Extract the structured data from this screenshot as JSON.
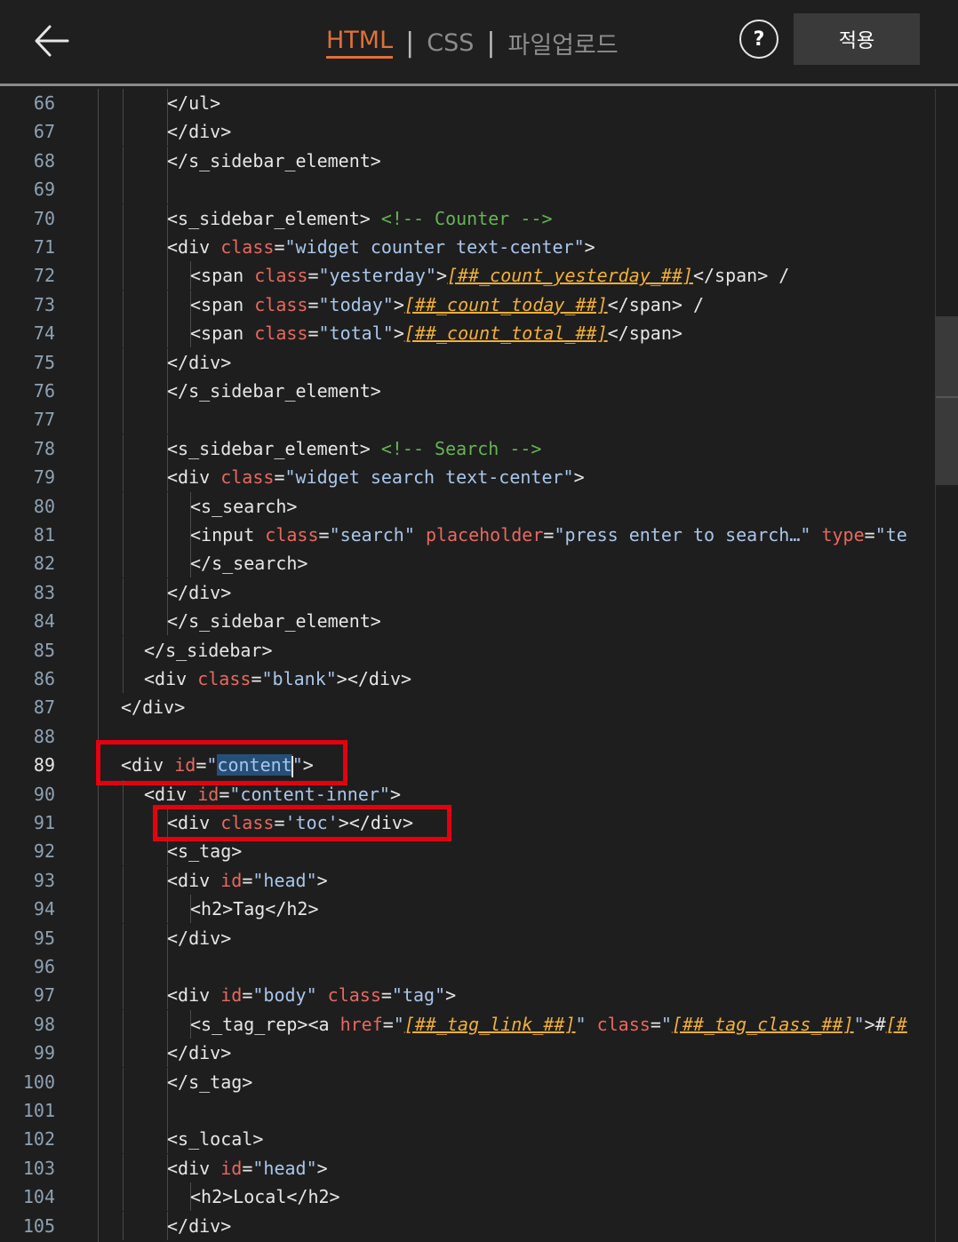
{
  "header": {
    "tabs": [
      {
        "label": "HTML",
        "active": true
      },
      {
        "label": "CSS",
        "active": false
      },
      {
        "label": "파일업로드",
        "active": false
      }
    ],
    "separator": "|",
    "help_label": "?",
    "apply_label": "적용",
    "back_icon": "arrow-left-icon"
  },
  "colors": {
    "accent": "#e0703a",
    "background": "#1e1e1e",
    "highlight_box": "#e3000f",
    "attr": "#e8685f",
    "string": "#a9c6ea",
    "comment": "#66b356",
    "template": "#f2b035"
  },
  "editor": {
    "current_line": "89",
    "lines": [
      {
        "n": "66",
        "indent": 2,
        "t": [
          [
            "tag",
            "</ul>"
          ]
        ]
      },
      {
        "n": "67",
        "indent": 2,
        "t": [
          [
            "tag",
            "</div>"
          ]
        ]
      },
      {
        "n": "68",
        "indent": 2,
        "t": [
          [
            "tag",
            "</s_sidebar_element>"
          ]
        ]
      },
      {
        "n": "69",
        "indent": 2,
        "t": []
      },
      {
        "n": "70",
        "indent": 2,
        "t": [
          [
            "tag",
            "<s_sidebar_element> "
          ],
          [
            "cmt",
            "<!-- Counter -->"
          ]
        ]
      },
      {
        "n": "71",
        "indent": 2,
        "t": [
          [
            "tag",
            "<div "
          ],
          [
            "attr",
            "class"
          ],
          [
            "tag",
            "="
          ],
          [
            "str",
            "\"widget counter text-center\""
          ],
          [
            "tag",
            ">"
          ]
        ]
      },
      {
        "n": "72",
        "indent": 3,
        "t": [
          [
            "tag",
            "<span "
          ],
          [
            "attr",
            "class"
          ],
          [
            "tag",
            "="
          ],
          [
            "str",
            "\"yesterday\""
          ],
          [
            "tag",
            ">"
          ],
          [
            "tpl",
            "[##_count_yesterday_##]"
          ],
          [
            "tag",
            "</span> /"
          ]
        ]
      },
      {
        "n": "73",
        "indent": 3,
        "t": [
          [
            "tag",
            "<span "
          ],
          [
            "attr",
            "class"
          ],
          [
            "tag",
            "="
          ],
          [
            "str",
            "\"today\""
          ],
          [
            "tag",
            ">"
          ],
          [
            "tpl",
            "[##_count_today_##]"
          ],
          [
            "tag",
            "</span> /"
          ]
        ]
      },
      {
        "n": "74",
        "indent": 3,
        "t": [
          [
            "tag",
            "<span "
          ],
          [
            "attr",
            "class"
          ],
          [
            "tag",
            "="
          ],
          [
            "str",
            "\"total\""
          ],
          [
            "tag",
            ">"
          ],
          [
            "tpl",
            "[##_count_total_##]"
          ],
          [
            "tag",
            "</span>"
          ]
        ]
      },
      {
        "n": "75",
        "indent": 2,
        "t": [
          [
            "tag",
            "</div>"
          ]
        ]
      },
      {
        "n": "76",
        "indent": 2,
        "t": [
          [
            "tag",
            "</s_sidebar_element>"
          ]
        ]
      },
      {
        "n": "77",
        "indent": 2,
        "t": []
      },
      {
        "n": "78",
        "indent": 2,
        "t": [
          [
            "tag",
            "<s_sidebar_element> "
          ],
          [
            "cmt",
            "<!-- Search -->"
          ]
        ]
      },
      {
        "n": "79",
        "indent": 2,
        "t": [
          [
            "tag",
            "<div "
          ],
          [
            "attr",
            "class"
          ],
          [
            "tag",
            "="
          ],
          [
            "str",
            "\"widget search text-center\""
          ],
          [
            "tag",
            ">"
          ]
        ]
      },
      {
        "n": "80",
        "indent": 3,
        "t": [
          [
            "tag",
            "<s_search>"
          ]
        ]
      },
      {
        "n": "81",
        "indent": 3,
        "t": [
          [
            "tag",
            "<input "
          ],
          [
            "attr",
            "class"
          ],
          [
            "tag",
            "="
          ],
          [
            "str",
            "\"search\" "
          ],
          [
            "attr",
            "placeholder"
          ],
          [
            "tag",
            "="
          ],
          [
            "str",
            "\"press enter to search…\" "
          ],
          [
            "attr",
            "type"
          ],
          [
            "tag",
            "="
          ],
          [
            "str",
            "\"te"
          ]
        ]
      },
      {
        "n": "82",
        "indent": 3,
        "t": [
          [
            "tag",
            "</s_search>"
          ]
        ]
      },
      {
        "n": "83",
        "indent": 2,
        "t": [
          [
            "tag",
            "</div>"
          ]
        ]
      },
      {
        "n": "84",
        "indent": 2,
        "t": [
          [
            "tag",
            "</s_sidebar_element>"
          ]
        ]
      },
      {
        "n": "85",
        "indent": 1,
        "t": [
          [
            "tag",
            "</s_sidebar>"
          ]
        ]
      },
      {
        "n": "86",
        "indent": 1,
        "t": [
          [
            "tag",
            "<div "
          ],
          [
            "attr",
            "class"
          ],
          [
            "tag",
            "="
          ],
          [
            "str",
            "\"blank\""
          ],
          [
            "tag",
            "></div>"
          ]
        ]
      },
      {
        "n": "87",
        "indent": 0,
        "t": [
          [
            "tag",
            "</div>"
          ]
        ]
      },
      {
        "n": "88",
        "indent": 0,
        "t": []
      },
      {
        "n": "89",
        "indent": 0,
        "t": [
          [
            "tag",
            "<div "
          ],
          [
            "attr",
            "id"
          ],
          [
            "tag",
            "="
          ],
          [
            "str",
            "\""
          ],
          [
            "sel",
            "content"
          ],
          [
            "caret",
            ""
          ],
          [
            "str",
            "\""
          ],
          [
            "tag",
            ">"
          ]
        ]
      },
      {
        "n": "90",
        "indent": 1,
        "t": [
          [
            "tag",
            "<div "
          ],
          [
            "attr",
            "id"
          ],
          [
            "tag",
            "="
          ],
          [
            "str",
            "\"content-inner\""
          ],
          [
            "tag",
            ">"
          ]
        ]
      },
      {
        "n": "91",
        "indent": 2,
        "t": [
          [
            "tag",
            "<div "
          ],
          [
            "attr",
            "class"
          ],
          [
            "tag",
            "="
          ],
          [
            "str",
            "'toc'"
          ],
          [
            "tag",
            "></div>"
          ]
        ]
      },
      {
        "n": "92",
        "indent": 2,
        "t": [
          [
            "tag",
            "<s_tag>"
          ]
        ]
      },
      {
        "n": "93",
        "indent": 2,
        "t": [
          [
            "tag",
            "<div "
          ],
          [
            "attr",
            "id"
          ],
          [
            "tag",
            "="
          ],
          [
            "str",
            "\"head\""
          ],
          [
            "tag",
            ">"
          ]
        ]
      },
      {
        "n": "94",
        "indent": 3,
        "t": [
          [
            "tag",
            "<h2>Tag</h2>"
          ]
        ]
      },
      {
        "n": "95",
        "indent": 2,
        "t": [
          [
            "tag",
            "</div>"
          ]
        ]
      },
      {
        "n": "96",
        "indent": 2,
        "t": []
      },
      {
        "n": "97",
        "indent": 2,
        "t": [
          [
            "tag",
            "<div "
          ],
          [
            "attr",
            "id"
          ],
          [
            "tag",
            "="
          ],
          [
            "str",
            "\"body\" "
          ],
          [
            "attr",
            "class"
          ],
          [
            "tag",
            "="
          ],
          [
            "str",
            "\"tag\""
          ],
          [
            "tag",
            ">"
          ]
        ]
      },
      {
        "n": "98",
        "indent": 3,
        "t": [
          [
            "tag",
            "<s_tag_rep><a "
          ],
          [
            "attr",
            "href"
          ],
          [
            "tag",
            "="
          ],
          [
            "str",
            "\""
          ],
          [
            "tpl",
            "[##_tag_link_##]"
          ],
          [
            "str",
            "\" "
          ],
          [
            "attr",
            "class"
          ],
          [
            "tag",
            "="
          ],
          [
            "str",
            "\""
          ],
          [
            "tpl",
            "[##_tag_class_##]"
          ],
          [
            "str",
            "\""
          ],
          [
            "tag",
            ">#"
          ],
          [
            "tpl",
            "[#"
          ]
        ]
      },
      {
        "n": "99",
        "indent": 2,
        "t": [
          [
            "tag",
            "</div>"
          ]
        ]
      },
      {
        "n": "100",
        "indent": 2,
        "t": [
          [
            "tag",
            "</s_tag>"
          ]
        ]
      },
      {
        "n": "101",
        "indent": 2,
        "t": []
      },
      {
        "n": "102",
        "indent": 2,
        "t": [
          [
            "tag",
            "<s_local>"
          ]
        ]
      },
      {
        "n": "103",
        "indent": 2,
        "t": [
          [
            "tag",
            "<div "
          ],
          [
            "attr",
            "id"
          ],
          [
            "tag",
            "="
          ],
          [
            "str",
            "\"head\""
          ],
          [
            "tag",
            ">"
          ]
        ]
      },
      {
        "n": "104",
        "indent": 3,
        "t": [
          [
            "tag",
            "<h2>Local</h2>"
          ]
        ]
      },
      {
        "n": "105",
        "indent": 2,
        "t": [
          [
            "tag",
            "</div>"
          ]
        ]
      }
    ]
  }
}
